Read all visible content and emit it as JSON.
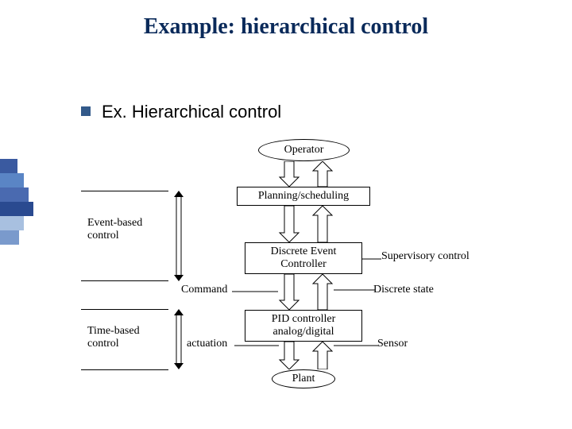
{
  "title": "Example: hierarchical control",
  "subheading": "Ex. Hierarchical control",
  "nodes": {
    "operator": "Operator",
    "planning": "Planning/scheduling",
    "dec": "Discrete Event\nController",
    "pid": "PID controller\nanalog/digital",
    "plant": "Plant"
  },
  "labels": {
    "event_based": "Event-based\ncontrol",
    "time_based": "Time-based\ncontrol",
    "command": "Command",
    "actuation": "actuation",
    "supervisory": "Supervisory control",
    "discrete_state": "Discrete state",
    "sensor": "Sensor"
  },
  "sidebar_colors": [
    "#3a5aa0",
    "#5a85c5",
    "#4a6ab0",
    "#2a4a90",
    "#a8c0e0",
    "#7a9acc"
  ]
}
